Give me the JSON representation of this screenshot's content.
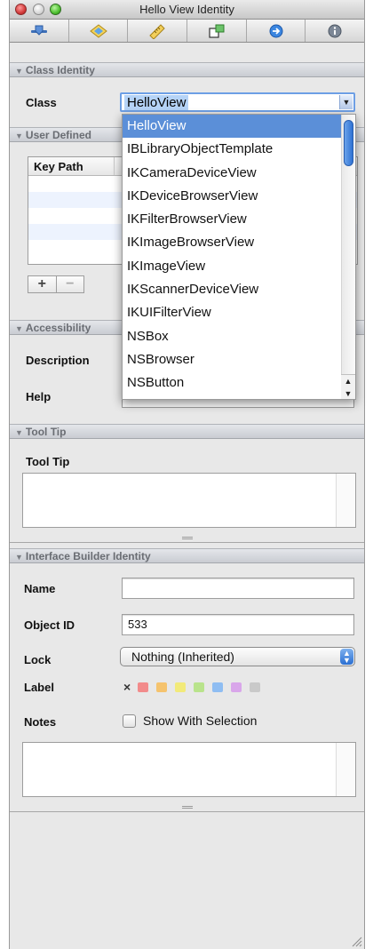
{
  "window": {
    "title": "Hello View Identity"
  },
  "toolbar": {
    "tabs": [
      {
        "name": "attributes-tab",
        "icon": "slider-icon"
      },
      {
        "name": "effects-tab",
        "icon": "diamond-icon"
      },
      {
        "name": "size-tab",
        "icon": "ruler-icon"
      },
      {
        "name": "connections-tab",
        "icon": "connections-icon"
      },
      {
        "name": "bindings-tab",
        "icon": "arrow-circle-icon"
      },
      {
        "name": "identity-tab",
        "icon": "info-icon"
      }
    ]
  },
  "class_identity": {
    "header": "Class Identity",
    "class_label": "Class",
    "class_value": "HelloView"
  },
  "class_dropdown": {
    "items": [
      "HelloView",
      "IBLibraryObjectTemplate",
      "IKCameraDeviceView",
      "IKDeviceBrowserView",
      "IKFilterBrowserView",
      "IKImageBrowserView",
      "IKImageView",
      "IKScannerDeviceView",
      "IKUIFilterView",
      "NSBox",
      "NSBrowser",
      "NSButton"
    ],
    "selected_index": 0
  },
  "user_defined": {
    "header": "User Defined",
    "key_path_col": "Key Path",
    "add_label": "+",
    "remove_label": "−"
  },
  "accessibility": {
    "header": "Accessibility",
    "description_label": "Description",
    "help_label": "Help"
  },
  "tool_tip": {
    "header": "Tool Tip",
    "label": "Tool Tip"
  },
  "ib_identity": {
    "header": "Interface Builder Identity",
    "name_label": "Name",
    "name_value": "",
    "object_id_label": "Object ID",
    "object_id_value": "533",
    "lock_label": "Lock",
    "lock_value": "Nothing (Inherited)",
    "label_label": "Label",
    "label_colors": [
      "#f28b8b",
      "#f5c36e",
      "#f2ea7a",
      "#b9e38c",
      "#8fbdf2",
      "#d9a6ea",
      "#c9c9c9"
    ],
    "notes_label": "Notes",
    "show_with_selection": "Show With Selection"
  }
}
